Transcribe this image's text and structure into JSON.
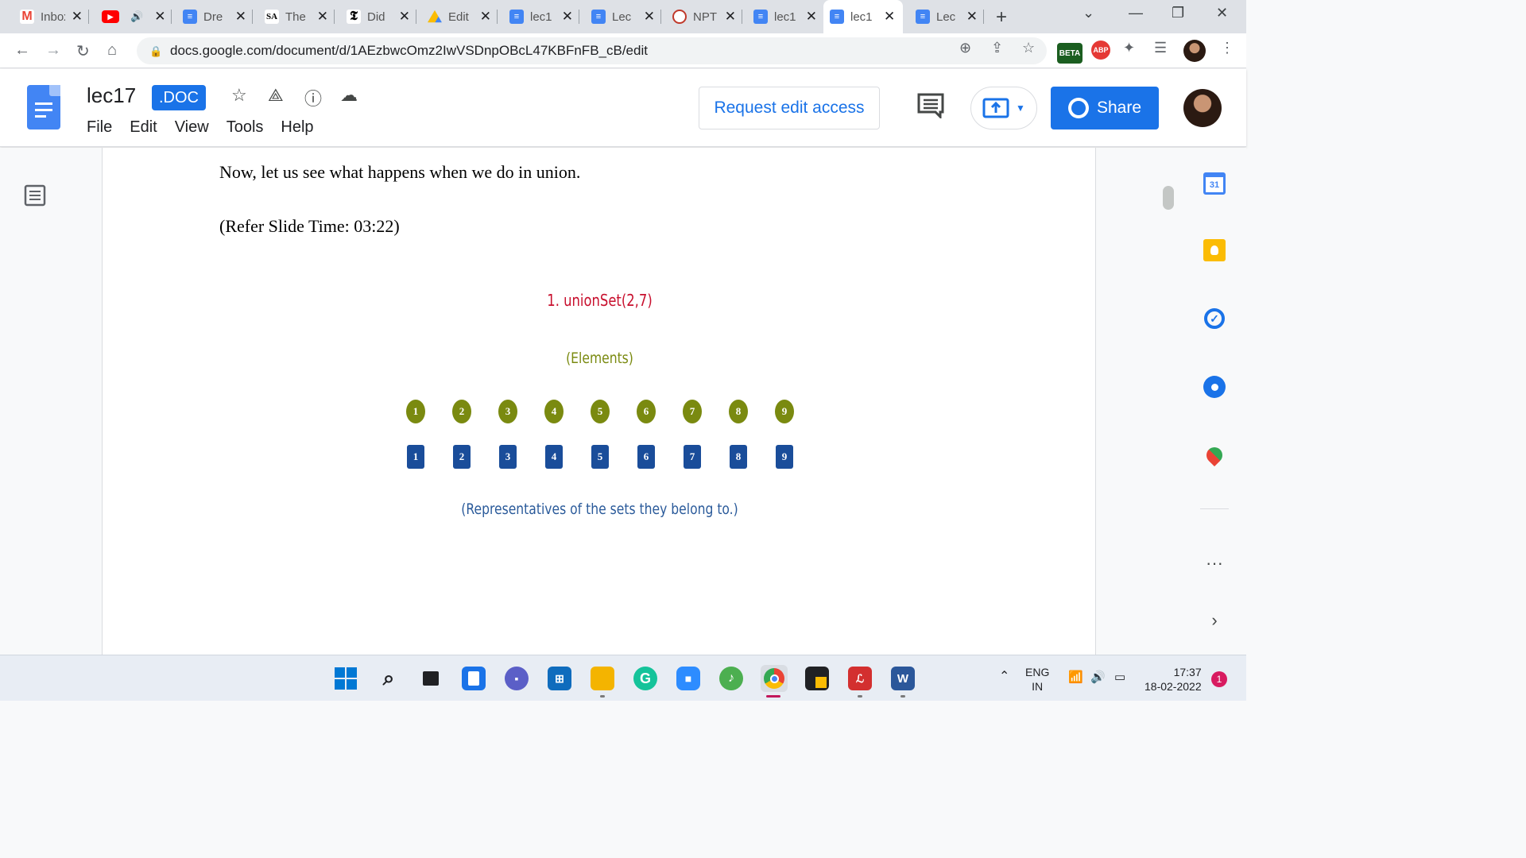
{
  "browser": {
    "tabs": [
      {
        "title": "Inbox",
        "icon": "gmail-icon",
        "color": "#ea4335"
      },
      {
        "title": "",
        "icon": "youtube-icon",
        "color": "#ff0000"
      },
      {
        "title": "Dre",
        "icon": "docs-icon",
        "color": "#4285f4"
      },
      {
        "title": "The",
        "icon": "sa-icon",
        "color": "#000000"
      },
      {
        "title": "Did",
        "icon": "nyt-icon",
        "color": "#000000"
      },
      {
        "title": "Edit",
        "icon": "drive-icon",
        "color": "#34a853"
      },
      {
        "title": "lec1",
        "icon": "docs-icon",
        "color": "#4285f4"
      },
      {
        "title": "Lec",
        "icon": "docs-icon",
        "color": "#4285f4"
      },
      {
        "title": "NPT",
        "icon": "nptel-icon",
        "color": "#c0392b"
      },
      {
        "title": "lec1",
        "icon": "docs-icon",
        "color": "#4285f4"
      },
      {
        "title": "lec1",
        "icon": "docs-icon",
        "color": "#4285f4"
      },
      {
        "title": "Lec",
        "icon": "docs-icon",
        "color": "#4285f4"
      }
    ],
    "active_tab": 10,
    "url": "docs.google.com/document/d/1AEzbwcOmz2IwVSDnpOBcL47KBFnFB_cB/edit",
    "ext_beta_label": "BETA",
    "ext_abp_label": "ABP"
  },
  "docs": {
    "title": "lec17",
    "badge": ".DOC",
    "menu": [
      "File",
      "Edit",
      "View",
      "Tools",
      "Help"
    ],
    "request_edit_label": "Request edit access",
    "share_label": "Share"
  },
  "document": {
    "para1": "Now, let us see what happens when we do in union.",
    "para2": "(Refer Slide Time: 03:22)",
    "slide": {
      "title": "1. unionSet(2,7)",
      "elements_label": "(Elements)",
      "elements": [
        "1",
        "2",
        "3",
        "4",
        "5",
        "6",
        "7",
        "8",
        "9"
      ],
      "representatives": [
        "1",
        "2",
        "3",
        "4",
        "5",
        "6",
        "7",
        "8",
        "9"
      ],
      "representatives_label": "(Representatives of the sets they belong to.)",
      "element_color": "#7a8a10",
      "rep_color": "#1a4d9a",
      "title_color": "#c8102e"
    }
  },
  "taskbar": {
    "lang_top": "ENG",
    "lang_bottom": "IN",
    "time": "17:37",
    "date": "18-02-2022",
    "notifications": "1"
  }
}
